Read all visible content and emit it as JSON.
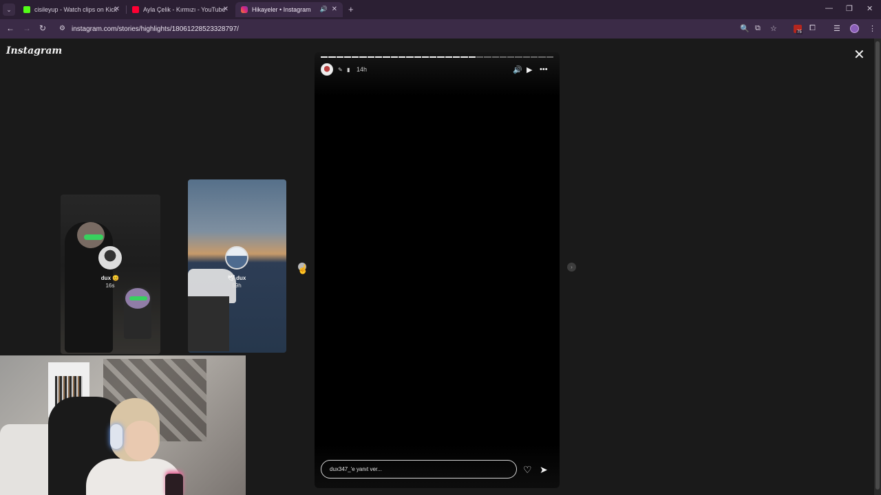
{
  "browser": {
    "tabs": [
      {
        "title": "cisileyup - Watch clips on Kick",
        "fav_color": "#53fc18",
        "active": false
      },
      {
        "title": "Ayla Çelik - Kırmızı - YouTube",
        "fav_color": "#ff0033",
        "active": false
      },
      {
        "title": "Hikayeler • Instagram",
        "fav_color": "#e1306c",
        "active": true
      }
    ],
    "url": "instagram.com/stories/highlights/18061228523328797/",
    "extension_badge_count": "75"
  },
  "instagram": {
    "logo": "Instagram",
    "previews": [
      {
        "name": "dux 😊",
        "time": "16s"
      },
      {
        "name": "🕊 dux",
        "time": "59h"
      }
    ],
    "story": {
      "time": "14h",
      "progress_total": 30,
      "progress_done": 20,
      "reply_placeholder": "dux347_'e yanıt ver..."
    }
  },
  "colors": {
    "chrome_bg": "#2b1f33",
    "toolbar_bg": "#3b2b47",
    "page_bg": "#1a1a1a"
  }
}
